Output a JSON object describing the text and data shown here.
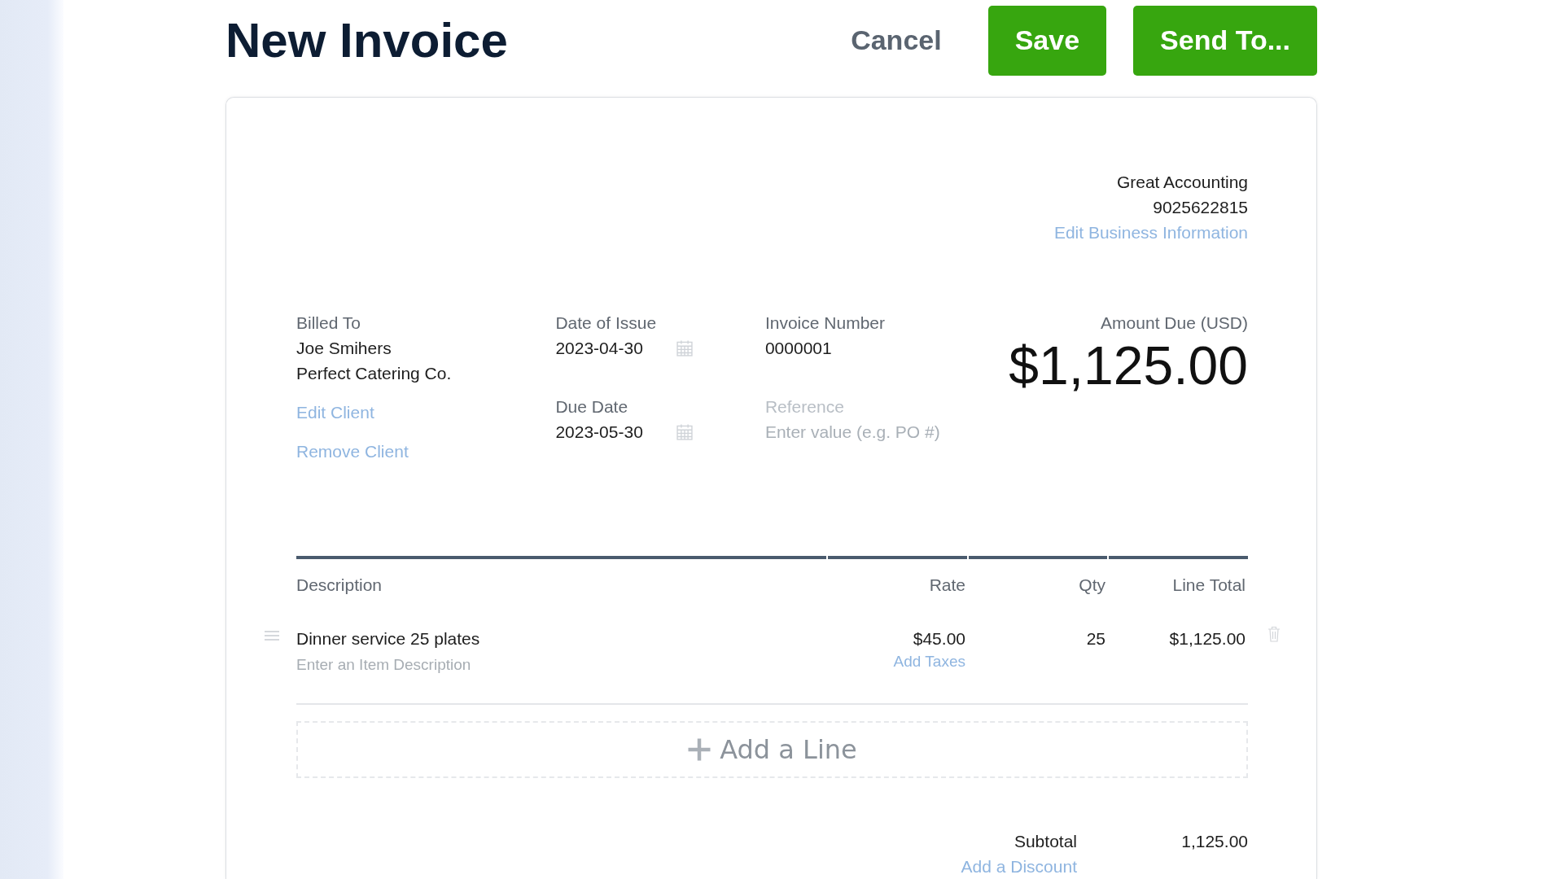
{
  "header": {
    "title": "New Invoice",
    "buttons": [
      {
        "label": "Cancel",
        "kind": "link"
      },
      {
        "label": "Save",
        "kind": "primary"
      },
      {
        "label": "Send To...",
        "kind": "primary"
      }
    ]
  },
  "business": {
    "name": "Great Accounting",
    "phone": "9025622815",
    "edit_link": "Edit Business Information"
  },
  "billed_to": {
    "label": "Billed To",
    "lines": [
      "Joe Smihers",
      "Perfect Catering Co."
    ],
    "links": [
      "Edit Client",
      "Remove Client"
    ]
  },
  "dates": [
    {
      "label": "Date of Issue",
      "value": "2023-04-30"
    },
    {
      "label": "Due Date",
      "value": "2023-05-30"
    }
  ],
  "invoice_number": {
    "label": "Invoice Number",
    "value": "0000001"
  },
  "reference": {
    "label": "Reference",
    "placeholder": "Enter value (e.g. PO #)"
  },
  "amount_due": {
    "label": "Amount Due (USD)",
    "value": "$1,125.00"
  },
  "table": {
    "columns": [
      "Description",
      "Rate",
      "Qty",
      "Line Total"
    ],
    "rows": [
      {
        "description": "Dinner service 25 plates",
        "placeholder": "Enter an Item Description",
        "rate": "$45.00",
        "taxes_link": "Add Taxes",
        "qty": "25",
        "total": "$1,125.00"
      }
    ],
    "add_line": "Add a Line"
  },
  "totals": {
    "label": "Subtotal",
    "value": "1,125.00",
    "discount_link": "Add a Discount"
  }
}
